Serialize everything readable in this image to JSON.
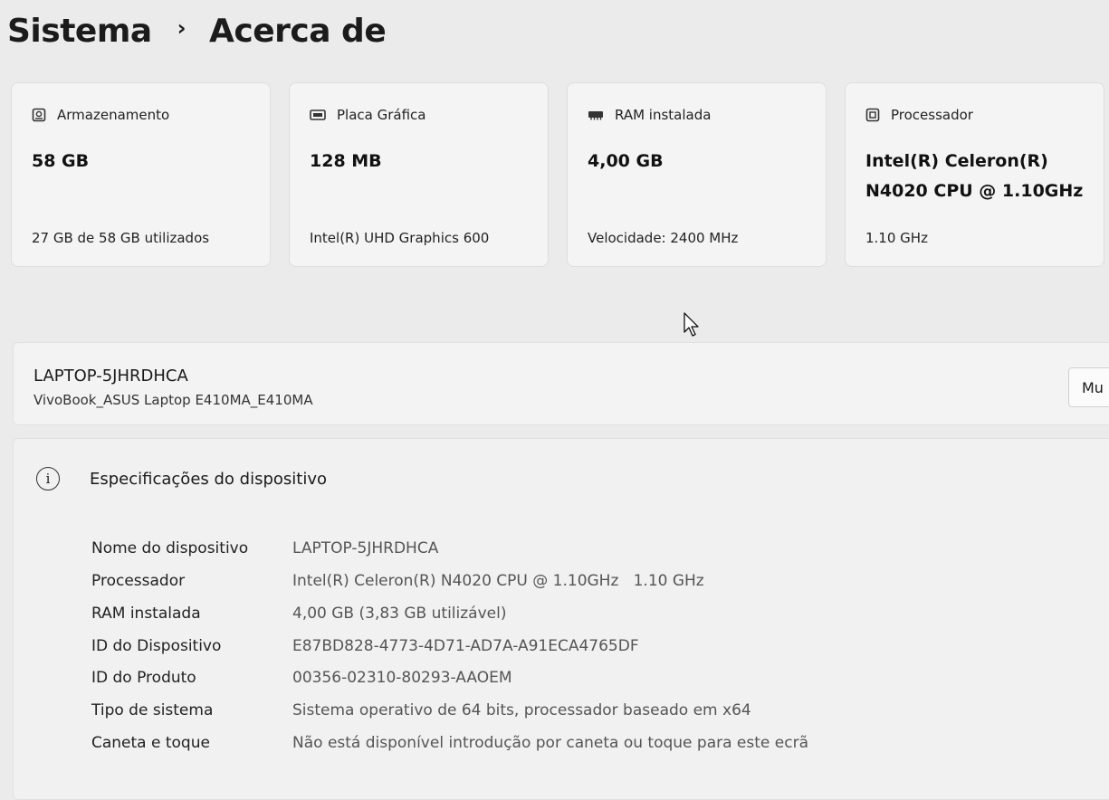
{
  "breadcrumb": {
    "parent": "Sistema",
    "separator": "›",
    "current": "Acerca de"
  },
  "cards": [
    {
      "icon": "storage-icon",
      "title": "Armazenamento",
      "value_line1": "58 GB",
      "value_line2": "",
      "sub": "27 GB de 58 GB utilizados"
    },
    {
      "icon": "graphics-card-icon",
      "title": "Placa Gráfica",
      "value_line1": "128 MB",
      "value_line2": "",
      "sub": "Intel(R) UHD Graphics 600"
    },
    {
      "icon": "ram-icon",
      "title": "RAM instalada",
      "value_line1": "4,00 GB",
      "value_line2": "",
      "sub": "Velocidade: 2400 MHz"
    },
    {
      "icon": "processor-icon",
      "title": "Processador",
      "value_line1": "Intel(R) Celeron(R)",
      "value_line2": "N4020 CPU @ 1.10GHz",
      "sub": "1.10 GHz"
    }
  ],
  "device": {
    "name": "LAPTOP-5JHRDHCA",
    "model": "VivoBook_ASUS Laptop E410MA_E410MA",
    "rename_label": "Mu"
  },
  "specs": {
    "title": "Especificações do dispositivo",
    "rows": [
      {
        "key": "Nome do dispositivo",
        "value": "LAPTOP-5JHRDHCA"
      },
      {
        "key": "Processador",
        "value": "Intel(R) Celeron(R) N4020 CPU @ 1.10GHz   1.10 GHz"
      },
      {
        "key": "RAM instalada",
        "value": "4,00 GB (3,83 GB utilizável)"
      },
      {
        "key": "ID do Dispositivo",
        "value": "E87BD828-4773-4D71-AD7A-A91ECA4765DF"
      },
      {
        "key": "ID do Produto",
        "value": "00356-02310-80293-AAOEM"
      },
      {
        "key": "Tipo de sistema",
        "value": "Sistema operativo de 64 bits, processador baseado em x64"
      },
      {
        "key": "Caneta e toque",
        "value": "Não está disponível introdução por caneta ou toque para este ecrã"
      }
    ]
  }
}
